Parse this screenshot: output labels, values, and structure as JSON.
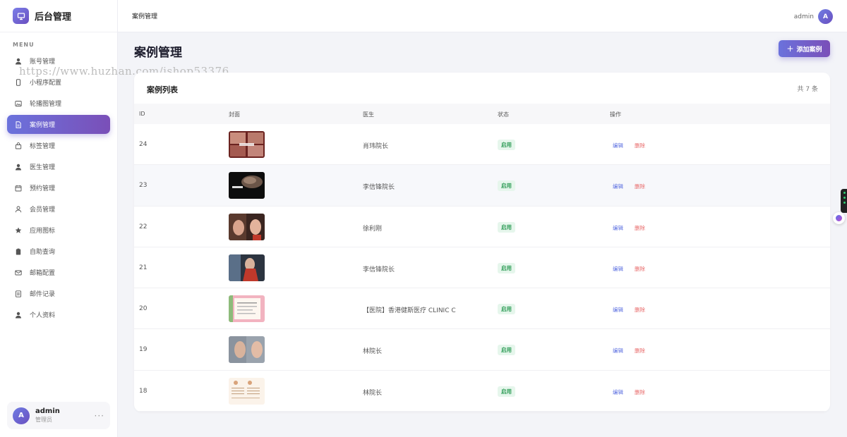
{
  "app": {
    "title": "后台管理"
  },
  "sidebar": {
    "menu_label": "MENU",
    "items": [
      {
        "label": "账号管理",
        "icon": "user-icon"
      },
      {
        "label": "小程序配置",
        "icon": "mobile-icon"
      },
      {
        "label": "轮播图管理",
        "icon": "image-icon"
      },
      {
        "label": "案例管理",
        "icon": "document-icon",
        "active": true
      },
      {
        "label": "标签管理",
        "icon": "bag-icon"
      },
      {
        "label": "医生管理",
        "icon": "user-icon"
      },
      {
        "label": "预约管理",
        "icon": "calendar-icon"
      },
      {
        "label": "会员管理",
        "icon": "user-outline-icon"
      },
      {
        "label": "应用图标",
        "icon": "star-icon"
      },
      {
        "label": "自助查询",
        "icon": "clipboard-icon"
      },
      {
        "label": "邮箱配置",
        "icon": "mail-icon"
      },
      {
        "label": "邮件记录",
        "icon": "list-icon"
      },
      {
        "label": "个人资料",
        "icon": "user-icon"
      }
    ],
    "user": {
      "initial": "A",
      "name": "admin",
      "role": "管理员",
      "more": "···"
    }
  },
  "topbar": {
    "breadcrumb": "案例管理",
    "username": "admin",
    "initial": "A"
  },
  "page": {
    "title": "案例管理",
    "add_button": "添加案例",
    "add_icon": "+"
  },
  "table": {
    "title": "案例列表",
    "count_text": "共 7 条",
    "columns": [
      "ID",
      "封面",
      "医生",
      "状态",
      "操作"
    ],
    "rows": [
      {
        "id": "24",
        "doctor": "肖玮院长",
        "status": "启用",
        "edit": "编辑",
        "delete": "删除"
      },
      {
        "id": "23",
        "doctor": "李信锋院长",
        "status": "启用",
        "edit": "编辑",
        "delete": "删除"
      },
      {
        "id": "22",
        "doctor": "徐利刚",
        "status": "启用",
        "edit": "编辑",
        "delete": "删除"
      },
      {
        "id": "21",
        "doctor": "李信锋院长",
        "status": "启用",
        "edit": "编辑",
        "delete": "删除"
      },
      {
        "id": "20",
        "doctor": "【医院】香港健斯医疗 CLINIC C",
        "status": "启用",
        "edit": "编辑",
        "delete": "删除"
      },
      {
        "id": "19",
        "doctor": "林院长",
        "status": "启用",
        "edit": "编辑",
        "delete": "删除"
      },
      {
        "id": "18",
        "doctor": "林院长",
        "status": "启用",
        "edit": "编辑",
        "delete": "删除"
      }
    ]
  },
  "watermark": "https://www.huzhan.com/ishop53376",
  "colors": {
    "accent": "#6b72dc",
    "accent2": "#7a4fb8",
    "status_green": "#2e9c56",
    "edit_blue": "#5a6ee0",
    "delete_red": "#e86a6a"
  }
}
